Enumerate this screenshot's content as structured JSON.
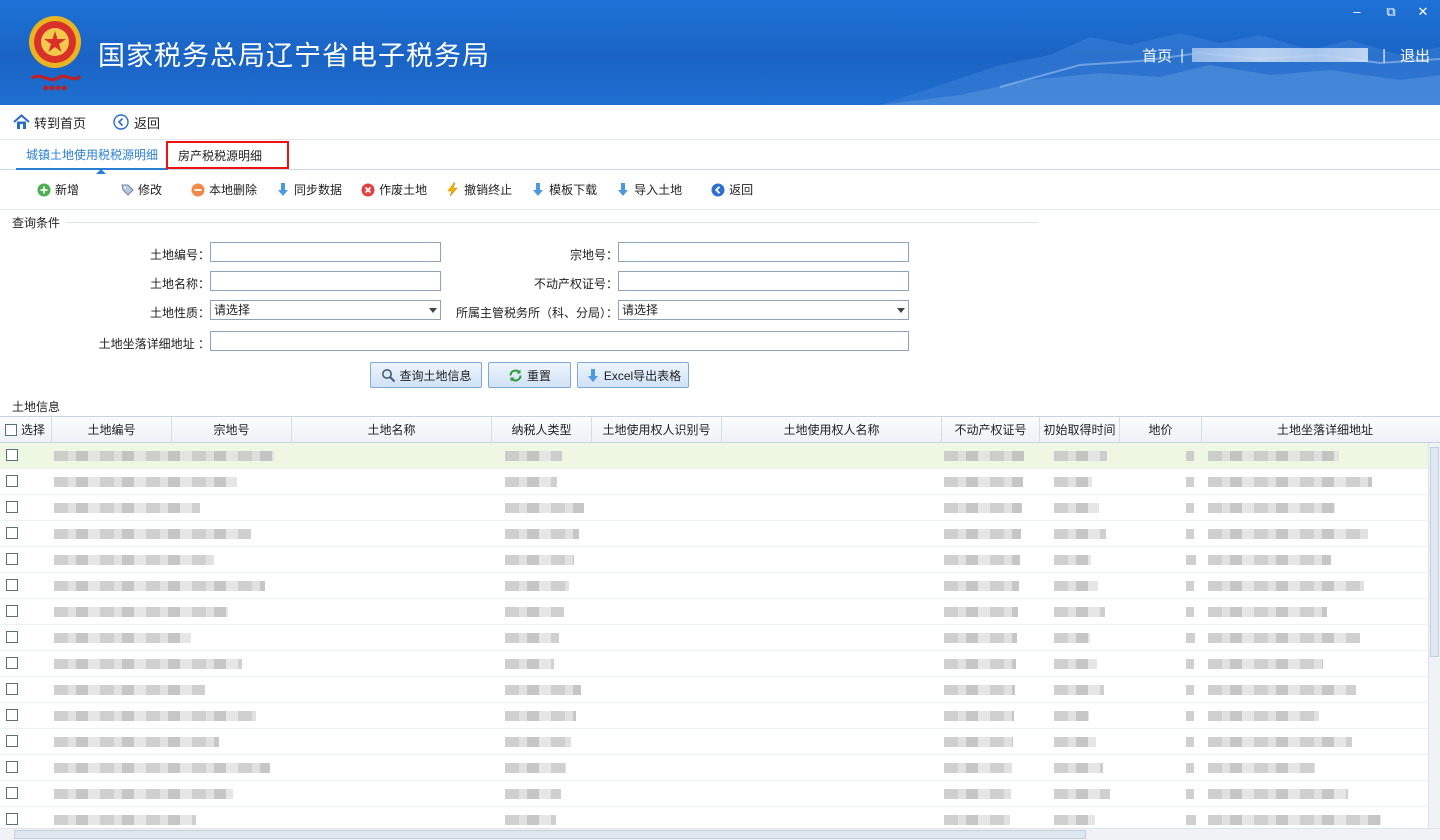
{
  "header": {
    "title": "国家税务总局辽宁省电子税务局",
    "nav_home": "首页",
    "nav_sep": "|",
    "nav_logout": "退出",
    "win_min": "‒",
    "win_restore": "⧉",
    "win_close": "✕"
  },
  "topnav": {
    "home": "转到首页",
    "back": "返回"
  },
  "tabs": {
    "land": "城镇土地使用税税源明细",
    "house": "房产税税源明细"
  },
  "actions": {
    "add": "新增",
    "edit": "修改",
    "local_delete": "本地删除",
    "sync": "同步数据",
    "void_land": "作废土地",
    "revoke": "撤销终止",
    "template": "模板下载",
    "import": "导入土地",
    "back": "返回"
  },
  "query": {
    "section_title": "查询条件",
    "land_no_label": "土地编号：",
    "parcel_no_label": "宗地号：",
    "land_name_label": "土地名称：",
    "property_cert_label": "不动产权证号：",
    "land_nature_label": "土地性质：",
    "land_nature_value": "请选择",
    "tax_office_label": "所属主管税务所（科、分局）：",
    "tax_office_value": "请选择",
    "address_label": "土地坐落详细地址 ："
  },
  "buttons": {
    "search": "查询土地信息",
    "reset": "重置",
    "export": "Excel导出表格"
  },
  "grid": {
    "section_title": "土地信息",
    "columns": [
      "选择",
      "土地编号",
      "宗地号",
      "土地名称",
      "纳税人类型",
      "土地使用权人识别号",
      "土地使用权人名称",
      "不动产权证号",
      "初始取得时间",
      "地价",
      "土地坐落详细地址"
    ],
    "row_count": 15
  },
  "colors": {
    "banner": "#1a63c4",
    "accent": "#2a7fd4",
    "highlight_border": "#e11111",
    "selected_row": "#eef7e2"
  }
}
